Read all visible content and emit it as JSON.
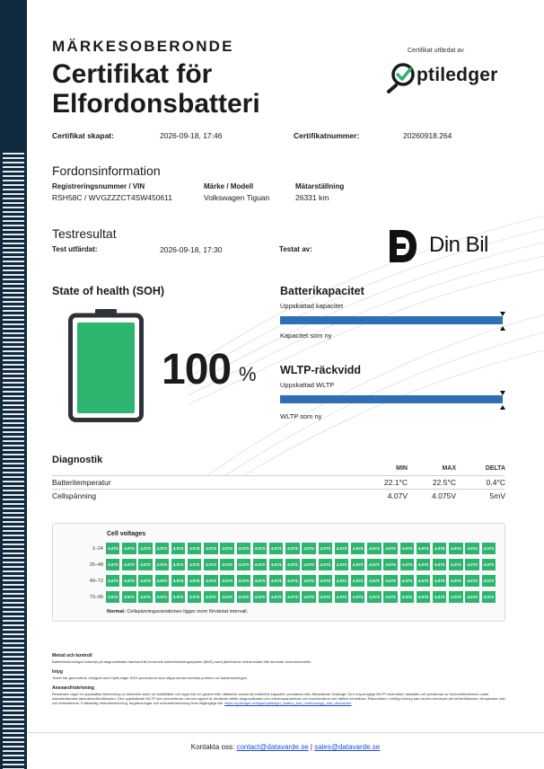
{
  "header": {
    "kicker": "MÄRKESOBERONDE",
    "title": "Certifikat för Elfordonsbatteri",
    "issuer_label": "Certifikat utfärdat av",
    "issuer_name": "ptiledger"
  },
  "meta": {
    "created_label": "Certifikat skapat:",
    "created_value": "2026-09-18, 17:46",
    "number_label": "Certifikatnummer:",
    "number_value": "20260918.264"
  },
  "vehicle": {
    "heading": "Fordonsinformation",
    "reg_label": "Registreringsnummer / VIN",
    "reg_value": "RSH58C / WVGZZZCT4SW450611",
    "model_label": "Märke / Modell",
    "model_value": "Volkswagen Tiguan",
    "odo_label": "Mätarställning",
    "odo_value": "26331 km"
  },
  "test": {
    "heading": "Testresultat",
    "date_label": "Test utfärdat:",
    "date_value": "2026-09-18, 17:30",
    "by_label": "Testat av:",
    "tester_name": "Din Bil"
  },
  "soh": {
    "heading": "State of health (SOH)",
    "value": "100",
    "unit": "%",
    "level": 1.0,
    "color": "#2db46e"
  },
  "capacity": {
    "heading": "Batterikapacitet",
    "top_label": "Uppskattad kapacitet",
    "bottom_label": "Kapacitet som ny",
    "ratio": 1.0
  },
  "wltp": {
    "heading": "WLTP-räckvidd",
    "top_label": "Uppskattad WLTP",
    "bottom_label": "WLTP som ny",
    "ratio": 1.0
  },
  "diagnostics": {
    "heading": "Diagnostik",
    "columns": [
      "MIN",
      "MAX",
      "DELTA"
    ],
    "rows": [
      {
        "label": "Batteritemperatur",
        "min": "22.1°C",
        "max": "22.5°C",
        "delta": "0.4°C"
      },
      {
        "label": "Cellspänning",
        "min": "4.07V",
        "max": "4.075V",
        "delta": "5mV"
      }
    ]
  },
  "cells": {
    "title": "Cell voltages",
    "color": "#2db46e",
    "rows": [
      {
        "label": "1–24",
        "values": [
          "4.074",
          "4.074",
          "4.073",
          "4.073",
          "4.074",
          "4.074",
          "4.074",
          "4.074",
          "4.073",
          "4.074",
          "4.074",
          "4.074",
          "4.074",
          "4.073",
          "4.073",
          "4.074",
          "4.074",
          "4.074",
          "4.073",
          "4.074",
          "4.075",
          "4.074",
          "4.074",
          "4.074"
        ]
      },
      {
        "label": "25–48",
        "values": [
          "4.072",
          "4.073",
          "4.072",
          "4.070",
          "4.073",
          "4.072",
          "4.073",
          "4.072",
          "4.073",
          "4.072",
          "4.074",
          "4.072",
          "4.070",
          "4.073",
          "4.073",
          "4.072",
          "4.072",
          "4.074",
          "4.073",
          "4.072",
          "4.073",
          "4.074",
          "4.073",
          "4.073"
        ]
      },
      {
        "label": "49–72",
        "values": [
          "4.073",
          "4.073",
          "4.073",
          "4.072",
          "4.074",
          "4.074",
          "4.073",
          "4.073",
          "4.073",
          "4.073",
          "4.074",
          "4.074",
          "4.074",
          "4.073",
          "4.071",
          "4.072",
          "4.072",
          "4.072",
          "4.073",
          "4.073",
          "4.073",
          "4.074",
          "4.073",
          "4.072"
        ]
      },
      {
        "label": "73–96",
        "values": [
          "4.072",
          "4.072",
          "4.071",
          "4.072",
          "4.072",
          "4.072",
          "4.072",
          "4.072",
          "4.072",
          "4.072",
          "4.072",
          "4.073",
          "4.073",
          "4.072",
          "4.072",
          "4.074",
          "4.073",
          "4.072",
          "4.072",
          "4.073",
          "4.073",
          "4.073",
          "4.073",
          "4.073"
        ]
      }
    ],
    "legend_bold": "Normal:",
    "legend_text": "Cellspänningsvariationen ligger inom förväntat intervall."
  },
  "fine_print": {
    "method_h": "Metod och kontroll",
    "method_p": "Batteribedömningen baseras på diagnostikdata hämtad från fordonets batterihanteringssystem (BMS) samt jämförande referensdata från liknande fordonsmodeller.",
    "integrity_h": "Intyg",
    "integrity_p": "Testet har genomförts i enlighet med OptiLedger SOH-proceduren utan några kända tekniska problem vid datainsamlingen.",
    "disclaimer_h": "Ansvarsfriskrivning",
    "disclaimer_p": "Resultaten utgör en uppskattad bedömning av batteriets skick vid testtillfället och utgör inte en garanti eller utfästelse avseende batteriets kapacitet, prestanda eller återstående livslängd. Den ursprungliga WLTP-räckvidden fastställs och publiceras av fordonstillverkaren under standardiserade laboratorieförhållanden. Den uppskattade WLTP som presenteras i denna rapport är beräknat utifrån diagnostikdata och referensparametrar och representerar inte faktisk körsträcka. Räckvidden i verklig körning kan variera beroende på körförhållanden, temperatur, last och körbeteende. Fullständig metodbeskrivning, begränsningar och ansvarsfriskrivning finns tillgängliga här:",
    "link_text": "https://optiledger.se/legal/optiledger_battery_test_methodology_and_disclaimer/"
  },
  "footer": {
    "prefix": "Kontakta oss:",
    "email1": "contact@datavarde.se",
    "separator": "|",
    "email2": "sales@datavarde.se"
  }
}
